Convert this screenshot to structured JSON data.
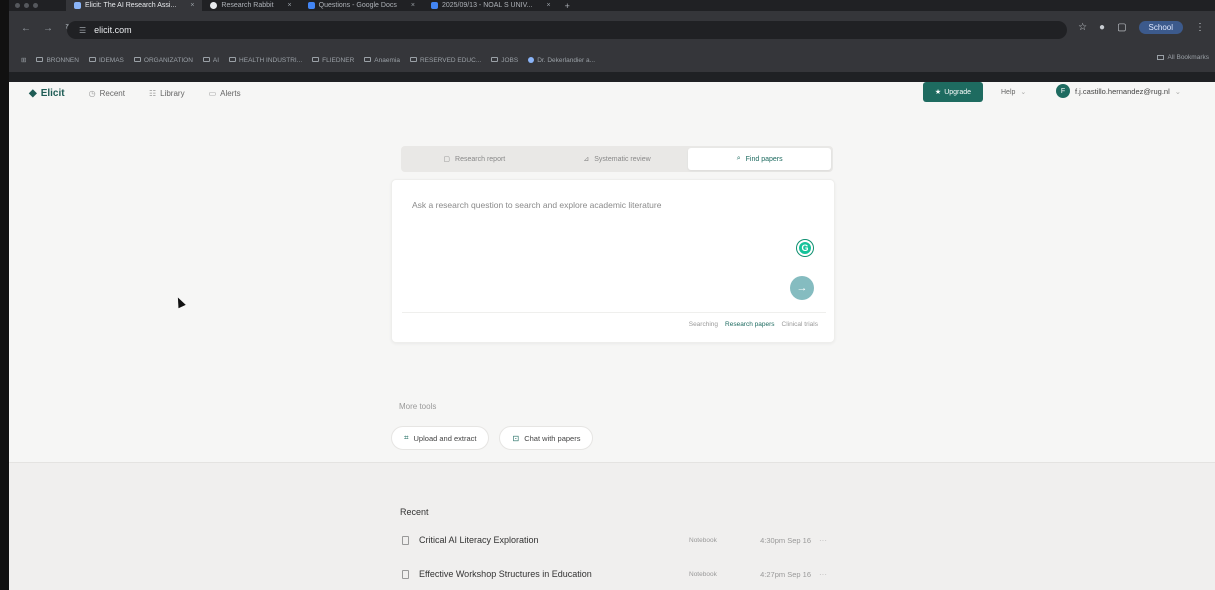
{
  "browser": {
    "tabs": [
      {
        "label": "Elicit: The AI Research Assi...",
        "active": true,
        "icon": "elicit-favicon",
        "color": "#8ab4f8"
      },
      {
        "label": "Research Rabbit",
        "active": false,
        "icon": "research-rabbit-favicon",
        "color": "#e8eaed"
      },
      {
        "label": "Questions - Google Docs",
        "active": false,
        "icon": "google-docs-favicon",
        "color": "#4285f4"
      },
      {
        "label": "2025/09/13 - NOAL S UNIV...",
        "active": false,
        "icon": "document-favicon",
        "color": "#4285f4"
      }
    ],
    "new_tab_glyph": "+",
    "url": "elicit.com",
    "profile_label": "School",
    "bookmarks": [
      "BRONNEN",
      "IDEMAS",
      "ORGANIZATION",
      "AI",
      "HEALTH INDUSTRI...",
      "FLIEDNER",
      "Anaemia",
      "RESERVED EDUC...",
      "JOBS",
      "Dr. Dekerlandier a..."
    ],
    "all_bookmarks_label": "All Bookmarks"
  },
  "app": {
    "logo_text": "Elicit",
    "nav": [
      {
        "label": "Recent",
        "icon": "clock-icon"
      },
      {
        "label": "Library",
        "icon": "library-icon"
      },
      {
        "label": "Alerts",
        "icon": "bell-icon"
      }
    ],
    "upgrade_label": "Upgrade",
    "help_label": "Help",
    "account_email": "f.j.castillo.hernandez@rug.nl",
    "avatar_initial": "F"
  },
  "modes": [
    {
      "label": "Research report",
      "icon": "report-icon",
      "active": false
    },
    {
      "label": "Systematic review",
      "icon": "review-icon",
      "active": false
    },
    {
      "label": "Find papers",
      "icon": "search-icon",
      "active": true
    }
  ],
  "search": {
    "placeholder": "Ask a research question to search and explore academic literature",
    "grammarly_glyph": "G",
    "submit_glyph": "→",
    "sources": [
      {
        "label": "Searching",
        "active": false
      },
      {
        "label": "Research papers",
        "active": true
      },
      {
        "label": "Clinical trials",
        "active": false
      }
    ]
  },
  "more_tools": {
    "label": "More tools",
    "tools": [
      {
        "label": "Upload and extract",
        "icon": "upload-icon"
      },
      {
        "label": "Chat with papers",
        "icon": "chat-icon"
      }
    ]
  },
  "recent": {
    "title": "Recent",
    "items": [
      {
        "title": "Critical AI Literacy Exploration",
        "kind": "Notebook",
        "time": "4:30pm Sep 16"
      },
      {
        "title": "Effective Workshop Structures in Education",
        "kind": "Notebook",
        "time": "4:27pm Sep 16"
      }
    ],
    "more_glyph": "···"
  },
  "colors": {
    "brand": "#1e6b60",
    "submit": "#85bcc0",
    "page_bg": "#f6f6f5"
  }
}
